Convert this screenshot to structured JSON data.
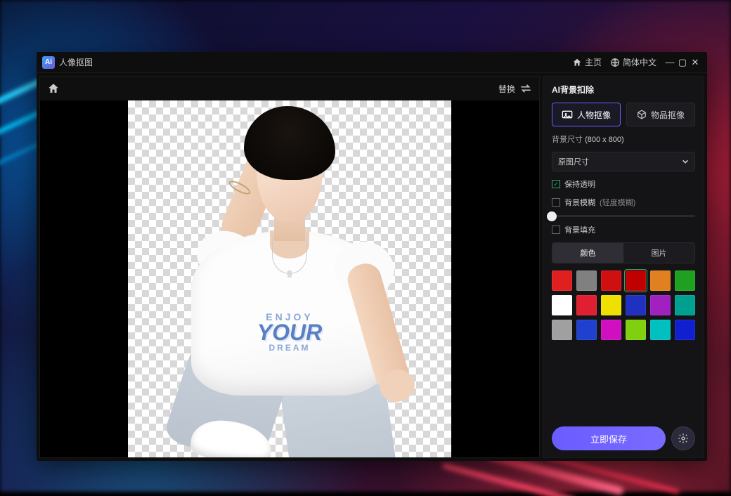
{
  "titlebar": {
    "app_name": "人像抠图",
    "home_label": "主页",
    "language_label": "简体中文"
  },
  "canvas": {
    "swap_label": "替换",
    "shirt_line1": "ENJOY",
    "shirt_line2": "YOUR",
    "shirt_line3": "DREAM"
  },
  "panel": {
    "title": "AI背景扣除",
    "mode_portrait": "人物抠像",
    "mode_object": "物品抠像",
    "bg_size_label": "背景尺寸",
    "bg_size_value": "(800 x 800)",
    "size_select": "原图尺寸",
    "keep_transparent": "保持透明",
    "bg_blur": "背景模糊",
    "bg_blur_level": "(轻度模糊)",
    "bg_fill": "背景填充",
    "tab_color": "颜色",
    "tab_image": "图片",
    "save_label": "立即保存"
  },
  "palette": [
    {
      "hex": "#e02020",
      "sel": false
    },
    {
      "hex": "#808080",
      "sel": false
    },
    {
      "hex": "#d01010",
      "sel": false
    },
    {
      "hex": "#c00000",
      "sel": true
    },
    {
      "hex": "#e08020",
      "sel": false
    },
    {
      "hex": "#20a020",
      "sel": false
    },
    {
      "hex": "#ffffff",
      "sel": false
    },
    {
      "hex": "#e02030",
      "sel": false
    },
    {
      "hex": "#f0e000",
      "sel": false
    },
    {
      "hex": "#2030c0",
      "sel": false
    },
    {
      "hex": "#a020c0",
      "sel": false
    },
    {
      "hex": "#00a090",
      "sel": false
    },
    {
      "hex": "#a0a0a0",
      "sel": false
    },
    {
      "hex": "#2040d0",
      "sel": false
    },
    {
      "hex": "#d010c0",
      "sel": false
    },
    {
      "hex": "#80d010",
      "sel": false
    },
    {
      "hex": "#00c0c0",
      "sel": false
    },
    {
      "hex": "#1020d0",
      "sel": false
    }
  ],
  "state": {
    "active_mode": "portrait",
    "keep_transparent_checked": true,
    "bg_blur_checked": false,
    "bg_fill_checked": false,
    "fill_active_tab": "color",
    "blur_slider_pos": 0
  }
}
